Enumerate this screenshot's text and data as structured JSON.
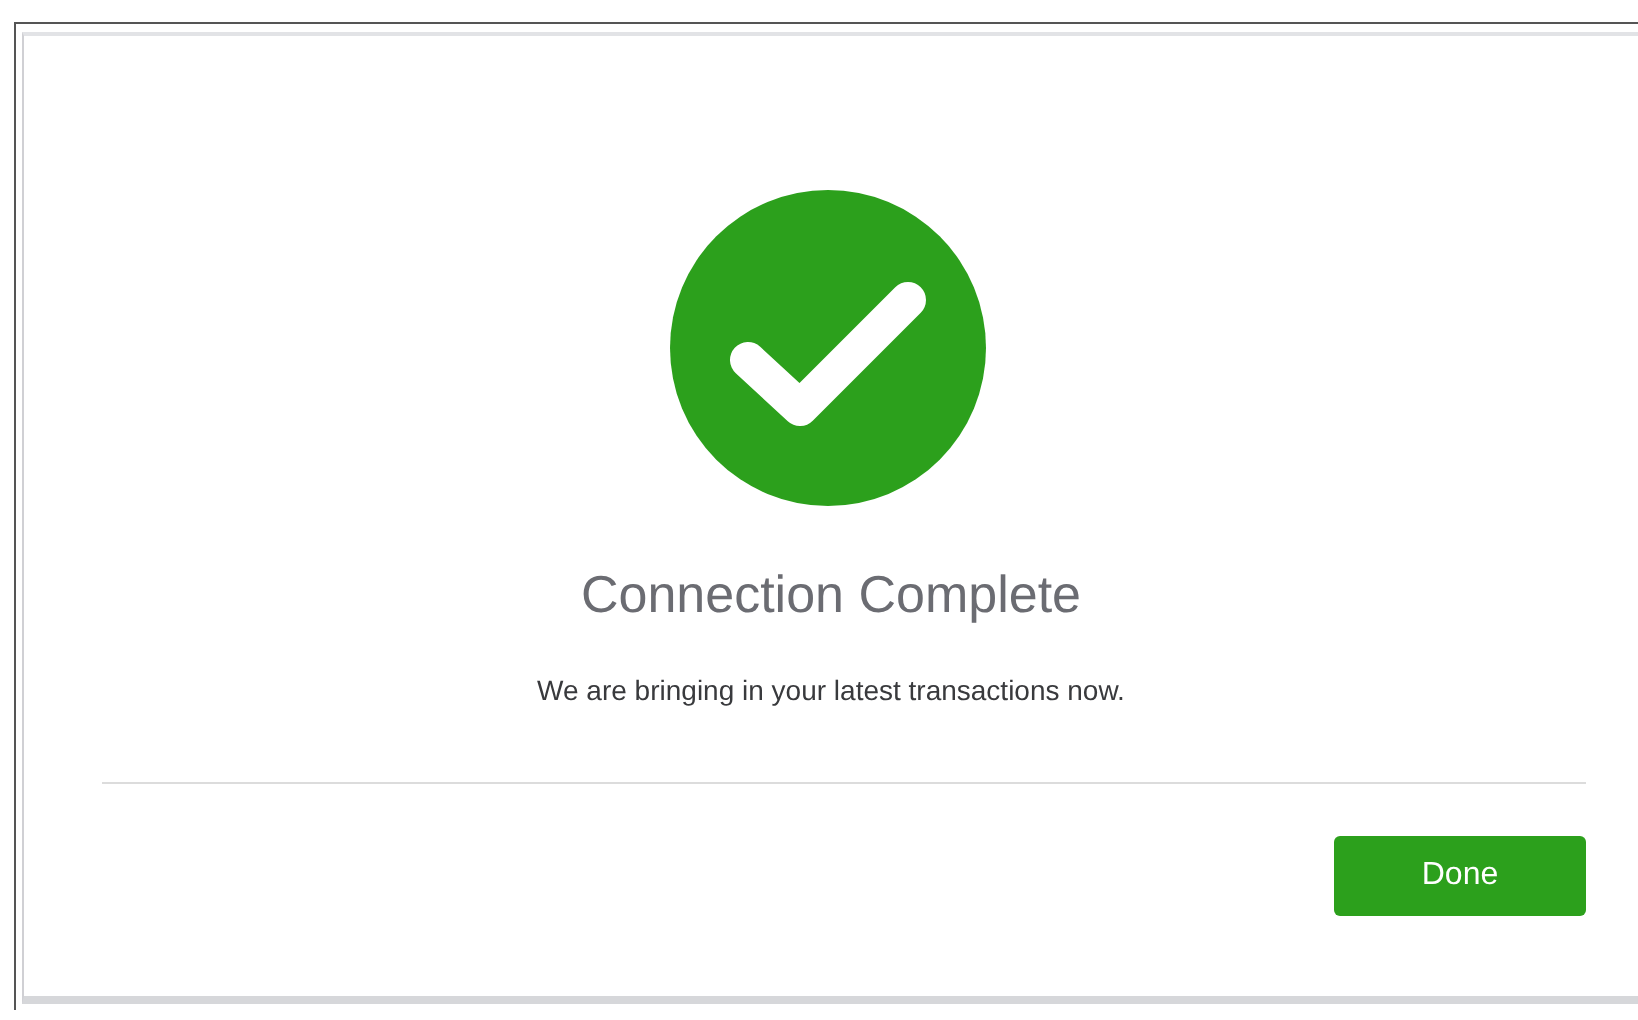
{
  "dialog": {
    "title": "Connection Complete",
    "message": "We are bringing in your latest transactions now.",
    "buttons": [
      {
        "label": "Done",
        "kind": "primary"
      }
    ]
  }
}
